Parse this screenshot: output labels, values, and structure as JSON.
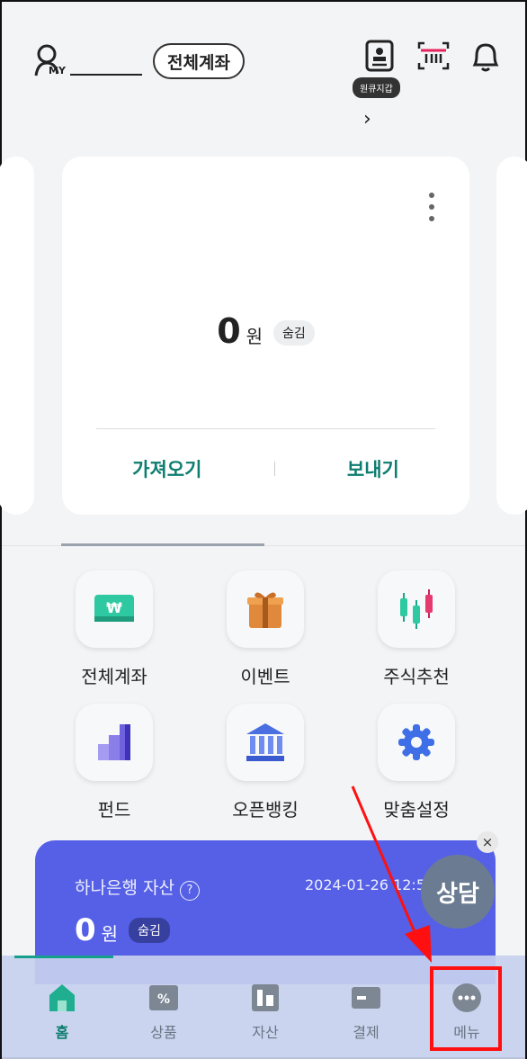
{
  "header": {
    "my_label": "MY",
    "all_accounts_button": "전체계좌",
    "wallet_tooltip": "원큐지갑"
  },
  "card": {
    "amount": "0",
    "unit": "원",
    "hide_badge": "숨김",
    "import_label": "가져오기",
    "send_label": "보내기"
  },
  "menu": [
    {
      "label": "전체계좌",
      "icon": "won-card-icon"
    },
    {
      "label": "이벤트",
      "icon": "gift-icon"
    },
    {
      "label": "주식추천",
      "icon": "candlestick-icon"
    },
    {
      "label": "펀드",
      "icon": "bar-chart-icon"
    },
    {
      "label": "오픈뱅킹",
      "icon": "bank-icon"
    },
    {
      "label": "맞춤설정",
      "icon": "gear-icon"
    }
  ],
  "asset": {
    "title": "하나은행 자산",
    "help": "?",
    "datetime": "2024-01-26 12:51:5",
    "amount": "0",
    "unit": "원",
    "hide_badge": "숨김"
  },
  "consult_button": "상담",
  "close_symbol": "×",
  "nav": [
    {
      "label": "홈",
      "icon": "home-icon",
      "active": true
    },
    {
      "label": "상품",
      "icon": "percent-ticket-icon"
    },
    {
      "label": "자산",
      "icon": "asset-icon"
    },
    {
      "label": "결제",
      "icon": "card-icon"
    },
    {
      "label": "메뉴",
      "icon": "more-icon"
    }
  ],
  "colors": {
    "accent": "#0d7d6f",
    "banner": "#5560e6",
    "highlight": "#ff1010"
  }
}
